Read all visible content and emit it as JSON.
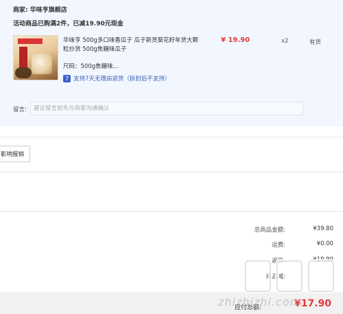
{
  "order": {
    "shop_label": "商家: 华味亨旗舰店",
    "promo_text": "活动商品已购满2件，已减19.90元现金",
    "item": {
      "title": "华味亨 500g多口味香瓜子 瓜子新货葵花籽年货大颗粒炒货 500g焦糖味瓜子",
      "spec": "尺码：500g焦糖味...",
      "return_policy": "支持7天无理由退货（拆封后不支持）",
      "price": "¥ 19.90",
      "qty": "x2",
      "stock": "有货"
    },
    "message_label": "留言:",
    "message_placeholder": "建议留言前先与商家沟通确认"
  },
  "invoice": {
    "button_label": "影响报销"
  },
  "summary": {
    "rows": [
      {
        "label": "总商品金额:",
        "value": "¥39.80"
      },
      {
        "label": "运费:",
        "value": "¥0.00"
      },
      {
        "label": "返现:",
        "value": "-¥19.90"
      },
      {
        "label": "商品减:",
        "value": ""
      }
    ],
    "payable_label": "应付总额:",
    "payable_value": "¥17.90"
  },
  "watermark": {
    "text": "zhizhizhi.com"
  },
  "colors": {
    "price_red": "#e4393c",
    "panel_bg": "#f2f7ff",
    "link_blue": "#3a5fb5"
  }
}
